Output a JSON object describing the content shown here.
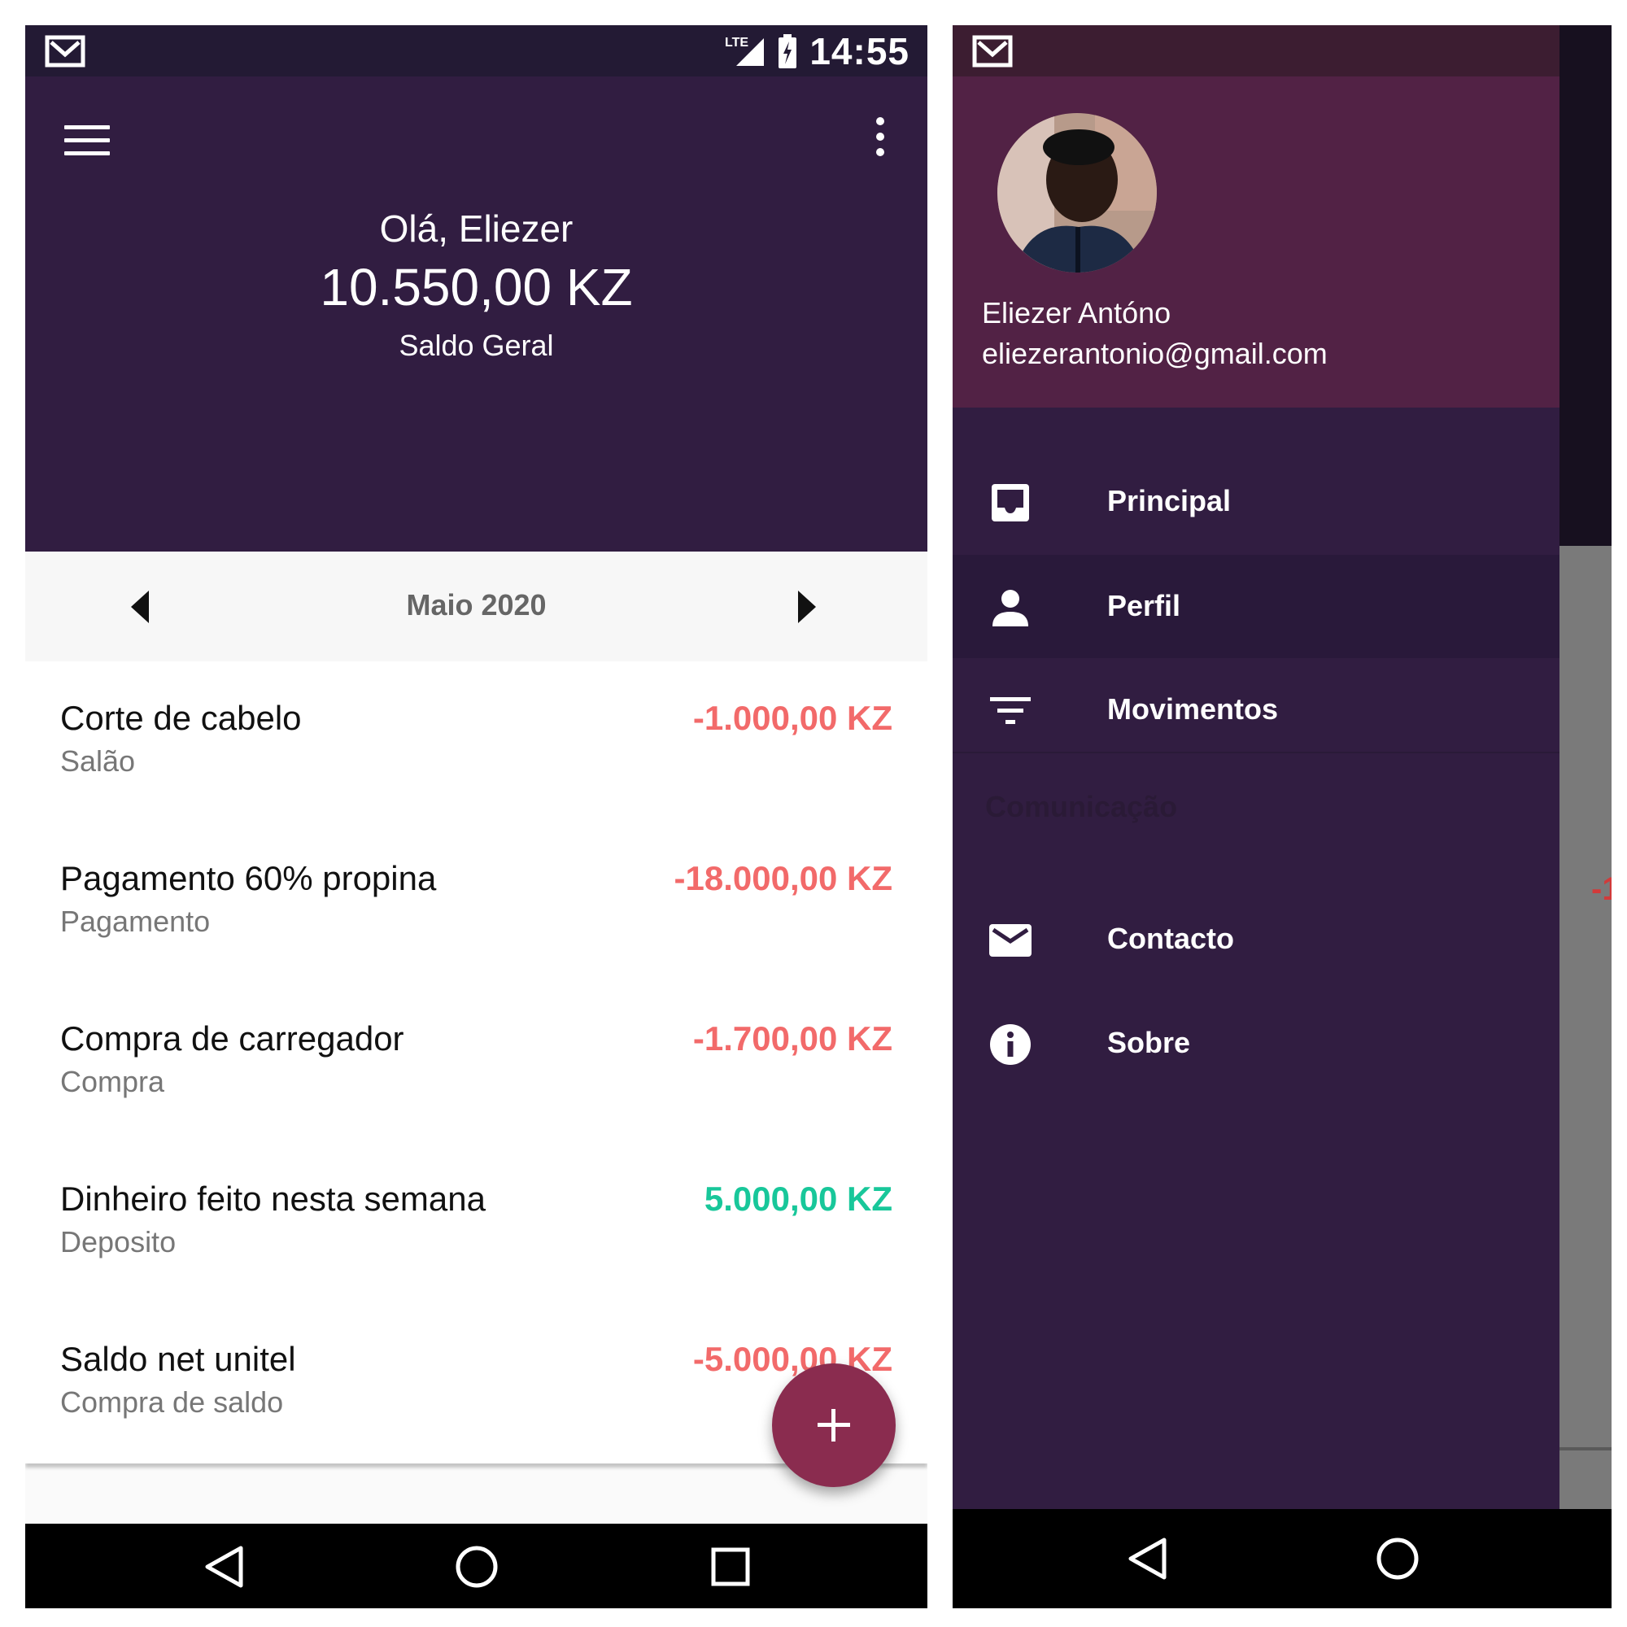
{
  "colors": {
    "header_bg": "#311d41",
    "status_bar": "#231a34",
    "drawer_header": "#522245",
    "expense": "#f26a6a",
    "income": "#18c79a",
    "fab": "#8a2c4f"
  },
  "left": {
    "status": {
      "network": "LTE",
      "time": "14:55",
      "notification_icon": "gmail-icon",
      "battery_icon": "battery-charging-icon"
    },
    "toolbar": {
      "menu_icon": "hamburger-icon",
      "overflow_icon": "more-vert-icon"
    },
    "header": {
      "greeting": "Olá, Eliezer",
      "balance": "10.550,00 KZ",
      "balance_label": "Saldo Geral"
    },
    "month": {
      "label": "Maio 2020",
      "prev_icon": "arrow-left-icon",
      "next_icon": "arrow-right-icon"
    },
    "transactions": [
      {
        "title": "Corte de cabelo",
        "category": "Salão",
        "amount": "-1.000,00 KZ",
        "type": "expense"
      },
      {
        "title": "Pagamento 60% propina",
        "category": "Pagamento",
        "amount": "-18.000,00 KZ",
        "type": "expense"
      },
      {
        "title": "Compra de carregador",
        "category": "Compra",
        "amount": "-1.700,00 KZ",
        "type": "expense"
      },
      {
        "title": "Dinheiro feito nesta semana",
        "category": "Deposito",
        "amount": "5.000,00 KZ",
        "type": "income"
      },
      {
        "title": "Saldo net unitel",
        "category": "Compra de saldo",
        "amount": "-5.000,00 KZ",
        "type": "expense"
      }
    ],
    "fab_icon": "plus-icon"
  },
  "right": {
    "drawer": {
      "user_name": "Eliezer Antóno",
      "user_email": "eliezerantonio@gmail.com",
      "items": [
        {
          "label": "Principal",
          "icon": "inbox-icon",
          "active": false
        },
        {
          "label": "Perfil",
          "icon": "person-icon",
          "active": true
        },
        {
          "label": "Movimentos",
          "icon": "filter-icon",
          "active": false
        }
      ],
      "section_label": "Comunicação",
      "section_items": [
        {
          "label": "Contacto",
          "icon": "mail-icon"
        },
        {
          "label": "Sobre",
          "icon": "info-icon"
        }
      ]
    },
    "behind_partial_amount": "-1"
  }
}
